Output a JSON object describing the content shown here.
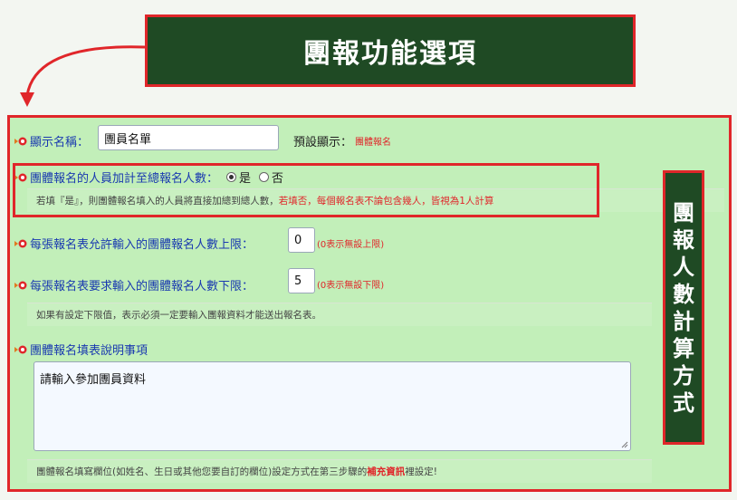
{
  "title": "團報功能選項",
  "side_label": [
    "團",
    "報",
    "人",
    "數",
    "計",
    "算",
    "方",
    "式"
  ],
  "fields": {
    "display_name": {
      "label": "顯示名稱：",
      "value": "團員名單",
      "default_label": "預設顯示：",
      "default_value": "團體報名"
    },
    "add_to_total": {
      "label": "團體報名的人員加計至總報名人數：",
      "opt_yes": "是",
      "opt_no": "否",
      "selected": "yes",
      "hint_normal": "若填『是』，則團體報名填入的人員將直接加總到總人數，",
      "hint_red": "若填否，每個報名表不論包含幾人，皆視為1人計算"
    },
    "max_count": {
      "label": "每張報名表允許輸入的團體報名人數上限：",
      "value": "0",
      "note": "(0表示無設上限)"
    },
    "min_count": {
      "label": "每張報名表要求輸入的團體報名人數下限：",
      "value": "5",
      "note": "(0表示無設下限)",
      "hint": "如果有設定下限值，表示必須一定要輸入團報資料才能送出報名表。"
    },
    "instructions": {
      "label": "團體報名填表說明事項",
      "value": "請輸入參加團員資料",
      "footer_a": "團體報名填寫欄位(如姓名、生日或其他您要自訂的欄位)設定方式在第三步驟的",
      "footer_link": "補充資訊",
      "footer_b": " 裡設定!"
    }
  },
  "colors": {
    "accent_red": "#e0262a",
    "dark_green": "#1f4a24",
    "panel_green": "#c2efb9",
    "label_blue": "#1a3ab0",
    "arrow_orange": "#e0603e"
  }
}
